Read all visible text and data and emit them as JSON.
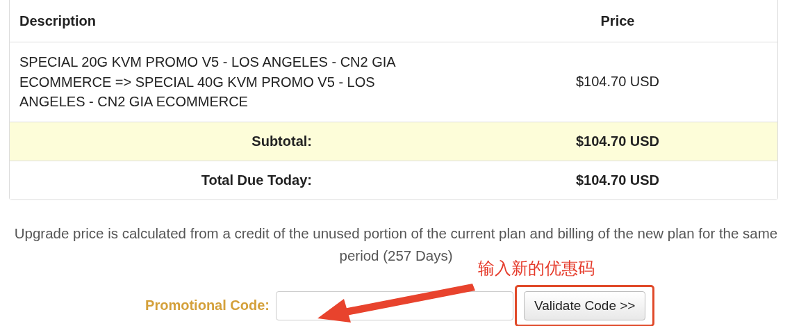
{
  "table": {
    "columns": [
      "Description",
      "Price"
    ],
    "rows": [
      {
        "description": "SPECIAL 20G KVM PROMO V5 - LOS ANGELES - CN2 GIA ECOMMERCE => SPECIAL 40G KVM PROMO V5 - LOS ANGELES - CN2 GIA ECOMMERCE",
        "price": "$104.70 USD"
      }
    ],
    "totals": [
      {
        "kind": "subtotal",
        "label": "Subtotal:",
        "value": "$104.70 USD"
      },
      {
        "kind": "total",
        "label": "Total Due Today:",
        "value": "$104.70 USD"
      }
    ]
  },
  "note": "Upgrade price is calculated from a credit of the unused portion of the current plan and billing of the new plan for the same period (257 Days)",
  "promo": {
    "label": "Promotional Code:",
    "button": "Validate Code >>"
  },
  "annotation": {
    "text": "输入新的优惠码"
  }
}
